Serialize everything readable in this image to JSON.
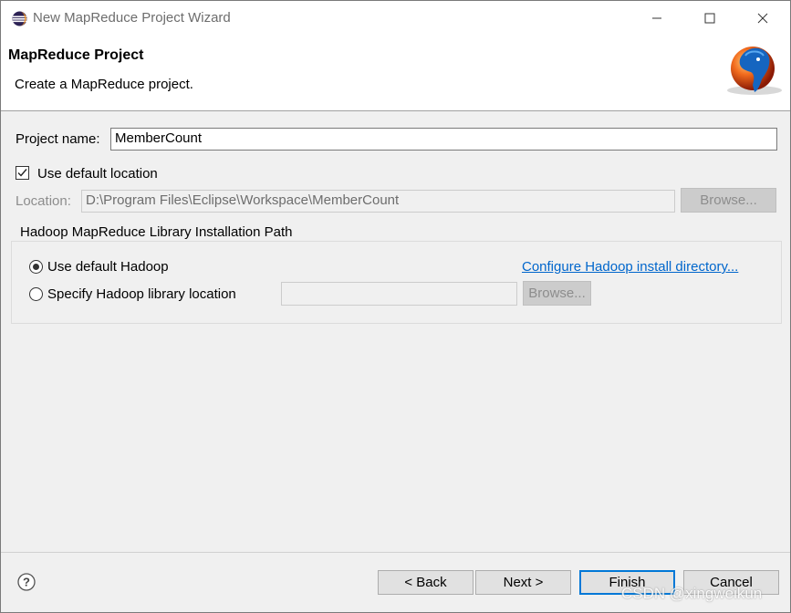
{
  "window": {
    "title": "New MapReduce Project Wizard",
    "icon": "eclipse-icon"
  },
  "header": {
    "title": "MapReduce Project",
    "description": "Create a MapReduce project.",
    "logo": "hadoop-elephant-logo"
  },
  "form": {
    "project_name_label": "Project name:",
    "project_name_value": "MemberCount",
    "use_default_location_label": "Use default location",
    "use_default_location_checked": true,
    "location_label": "Location:",
    "location_value": "D:\\Program Files\\Eclipse\\Workspace\\MemberCount",
    "browse_label": "Browse..."
  },
  "hadoop_group": {
    "title": "Hadoop MapReduce Library Installation Path",
    "use_default_label": "Use default Hadoop",
    "configure_link": "Configure Hadoop install directory...",
    "specify_label": "Specify Hadoop library location",
    "specify_value": "",
    "browse_label": "Browse..."
  },
  "footer": {
    "back_label": "< Back",
    "next_label": "Next >",
    "finish_label": "Finish",
    "cancel_label": "Cancel"
  },
  "watermark": "CSDN @xingweikun"
}
